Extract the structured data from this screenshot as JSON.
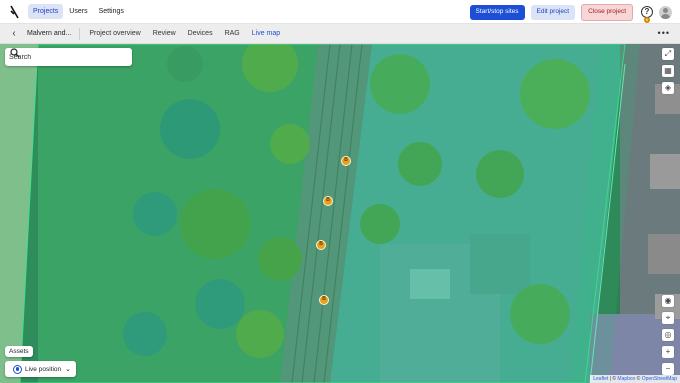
{
  "nav": {
    "items": [
      {
        "label": "Projects",
        "active": true
      },
      {
        "label": "Users",
        "active": false
      },
      {
        "label": "Settings",
        "active": false
      }
    ]
  },
  "actions": {
    "start_stop_label": "Start/stop sites",
    "edit_label": "Edit project",
    "close_label": "Close project"
  },
  "help": {
    "badge_count": "6",
    "icon": "help-icon"
  },
  "subnav": {
    "project_name": "Malvern and...",
    "tabs": [
      {
        "label": "Project overview",
        "active": false
      },
      {
        "label": "Review",
        "active": false
      },
      {
        "label": "Devices",
        "active": false
      },
      {
        "label": "RAG",
        "active": false
      },
      {
        "label": "Live map",
        "active": true
      }
    ]
  },
  "search": {
    "placeholder": "Search"
  },
  "map": {
    "assets_label": "Assets",
    "live_position_label": "Live position",
    "attribution": {
      "leaflet": "Leaflet",
      "separator": " | © ",
      "mapbox": "Mapbox",
      "osm_prefix": " © ",
      "osm": "OpenStreetMap"
    },
    "markers": [
      {
        "label": "B"
      },
      {
        "label": "B"
      },
      {
        "label": "B"
      },
      {
        "label": "B"
      }
    ]
  },
  "colors": {
    "primary": "#1d4fd6",
    "danger_bg": "#f6d6d6",
    "overlay": "#2fbf7a",
    "marker": "#e6a21e"
  }
}
